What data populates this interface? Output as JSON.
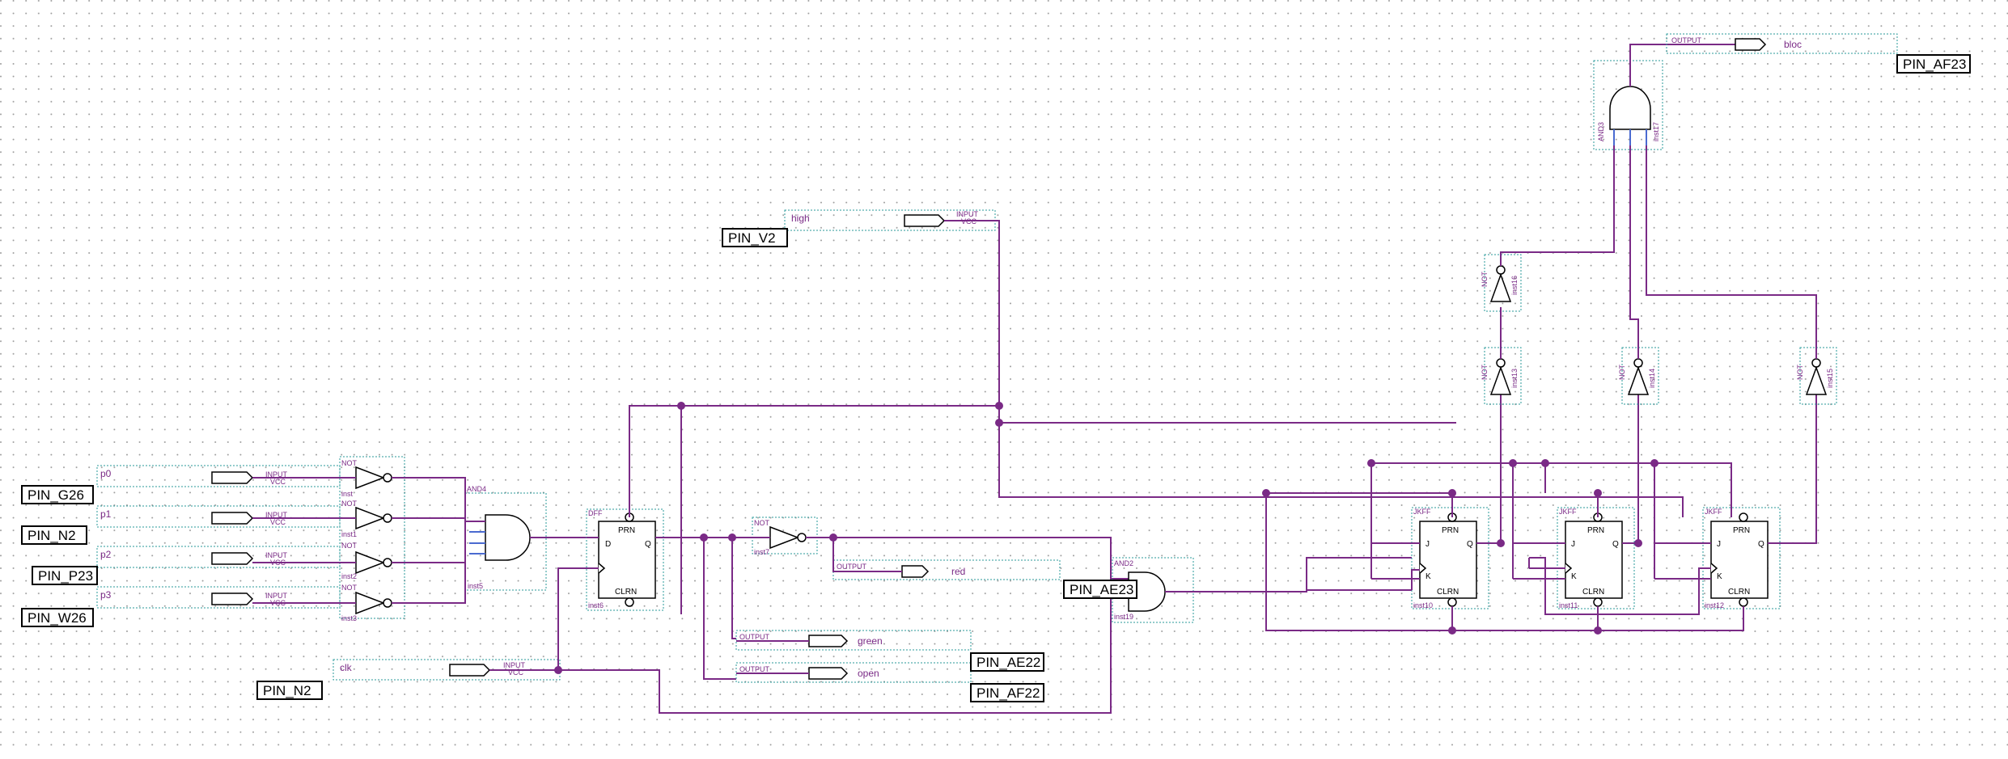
{
  "schematic": {
    "grid": {
      "color": "#b0b0b0"
    },
    "wire_color": "#7a2a86",
    "frame_color": "#2a9a9a",
    "pins": [
      "PIN_G26",
      "PIN_N2",
      "PIN_P23",
      "PIN_W26",
      "PIN_V2",
      "PIN_N2",
      "PIN_AE23",
      "PIN_AE22",
      "PIN_AF22",
      "PIN_AF23"
    ],
    "signals": {
      "p0": "p0",
      "p1": "p1",
      "p2": "p2",
      "p3": "p3",
      "high": "high",
      "clk": "clk",
      "red": "red",
      "green": "green",
      "open": "open",
      "bloc": "bloc"
    },
    "io": {
      "input": "INPUT",
      "vcc": "VCC",
      "output": "OUTPUT"
    },
    "parts": {
      "not": "NOT",
      "and4": "AND4",
      "and2": "AND2",
      "and3": "AND3",
      "dff": "DFF",
      "jkff": "JKFF"
    },
    "instances": {
      "inst": "inst",
      "inst1": "inst1",
      "inst2": "inst2",
      "inst3": "inst3",
      "inst5": "inst5",
      "inst6": "inst6",
      "inst7": "inst7",
      "inst10": "inst10",
      "inst11": "inst11",
      "inst12": "inst12",
      "inst13": "inst13",
      "inst14": "inst14",
      "inst15": "inst15",
      "inst16": "inst16",
      "inst17": "inst17",
      "inst19": "inst19"
    },
    "ff_ports": {
      "prn": "PRN",
      "clrn": "CLRN",
      "d": "D",
      "q": "Q",
      "j": "J",
      "k": "K"
    }
  }
}
